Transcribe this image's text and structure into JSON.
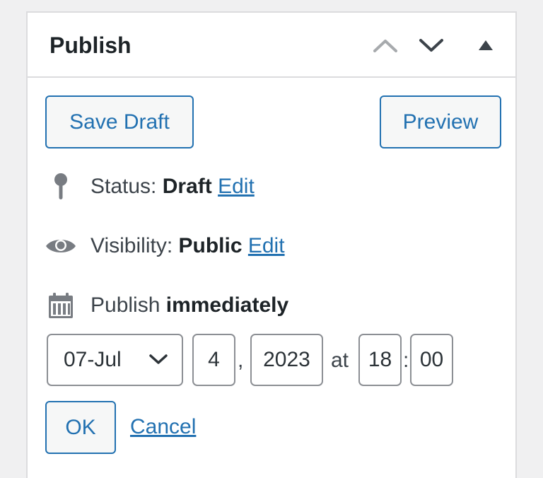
{
  "panel": {
    "title": "Publish",
    "header_icons": [
      "chevron-up-icon",
      "chevron-down-icon",
      "triangle-up-icon"
    ]
  },
  "actions": {
    "save_draft_label": "Save Draft",
    "preview_label": "Preview"
  },
  "status": {
    "icon": "pin-icon",
    "label": "Status:",
    "value": "Draft",
    "edit_label": "Edit"
  },
  "visibility": {
    "icon": "eye-icon",
    "label": "Visibility:",
    "value": "Public",
    "edit_label": "Edit"
  },
  "schedule": {
    "icon": "calendar-icon",
    "label": "Publish",
    "value": "immediately",
    "month": "07-Jul",
    "day": "4",
    "comma": ",",
    "year": "2023",
    "at": "at",
    "hour": "18",
    "colon": ":",
    "minute": "00",
    "ok_label": "OK",
    "cancel_label": "Cancel"
  },
  "colors": {
    "accent": "#2271b1",
    "border": "#dcdcde",
    "icon_gray": "#787c82"
  }
}
